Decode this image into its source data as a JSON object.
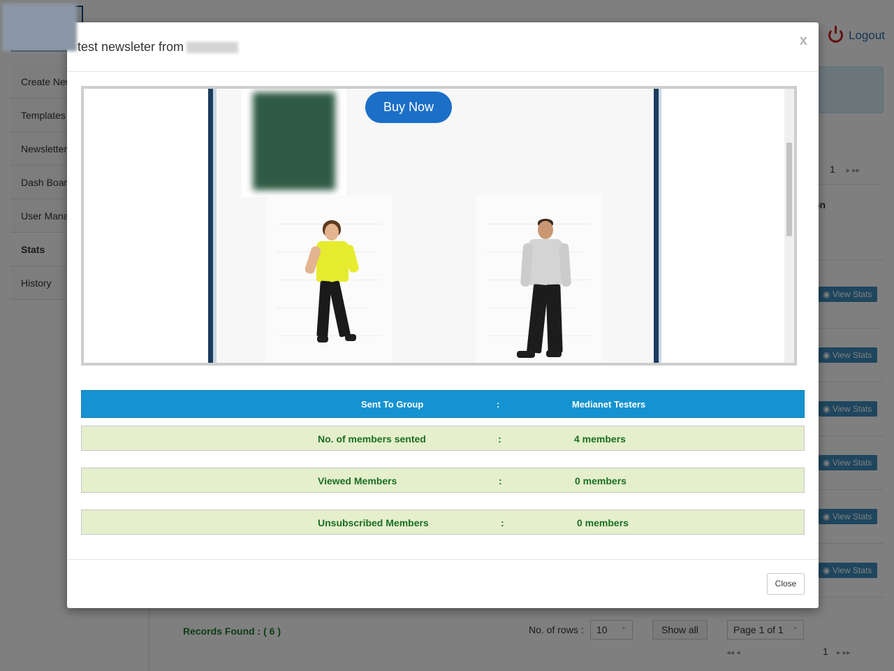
{
  "header": {
    "logout_label": "Logout"
  },
  "sidebar": {
    "items": [
      {
        "label": "Create New"
      },
      {
        "label": "Templates"
      },
      {
        "label": "Newsletter"
      },
      {
        "label": "Dash Board"
      },
      {
        "label": "User Manage"
      },
      {
        "label": "Stats"
      },
      {
        "label": "History"
      }
    ]
  },
  "background_table": {
    "top_page": "1",
    "pager_arrows": "▸ ▸▸",
    "column_partial": "on",
    "view_stats_label": "View Stats",
    "rows": 6
  },
  "footer_controls": {
    "records_found": "Records Found : ( 6 )",
    "rows_label": "No. of rows  :",
    "rows_value": "10",
    "show_all": "Show all",
    "page_select": "Page 1 of 1",
    "page_number": "1",
    "first_prev": "◂◂ ◂",
    "next_last": "▸ ▸▸"
  },
  "modal": {
    "title": "test newsleter from",
    "close_x": "x",
    "preview": {
      "buy_now": "Buy Now"
    },
    "stats": {
      "header": {
        "label": "Sent To Group",
        "sep": ":",
        "value": "Medianet Testers"
      },
      "rows": [
        {
          "label": "No. of members sented",
          "sep": ":",
          "value": "4 members"
        },
        {
          "label": "Viewed Members",
          "sep": ":",
          "value": "0 members"
        },
        {
          "label": "Unsubscribed Members",
          "sep": ":",
          "value": "0 members"
        }
      ]
    },
    "close_button": "Close"
  },
  "colors": {
    "stat_header_bg": "#1593d0",
    "stat_row_bg": "#e5efcc",
    "stat_row_text": "#1a6e23",
    "buy_now_bg": "#1b6fc7",
    "view_stats_bg": "#3c8dbc"
  }
}
